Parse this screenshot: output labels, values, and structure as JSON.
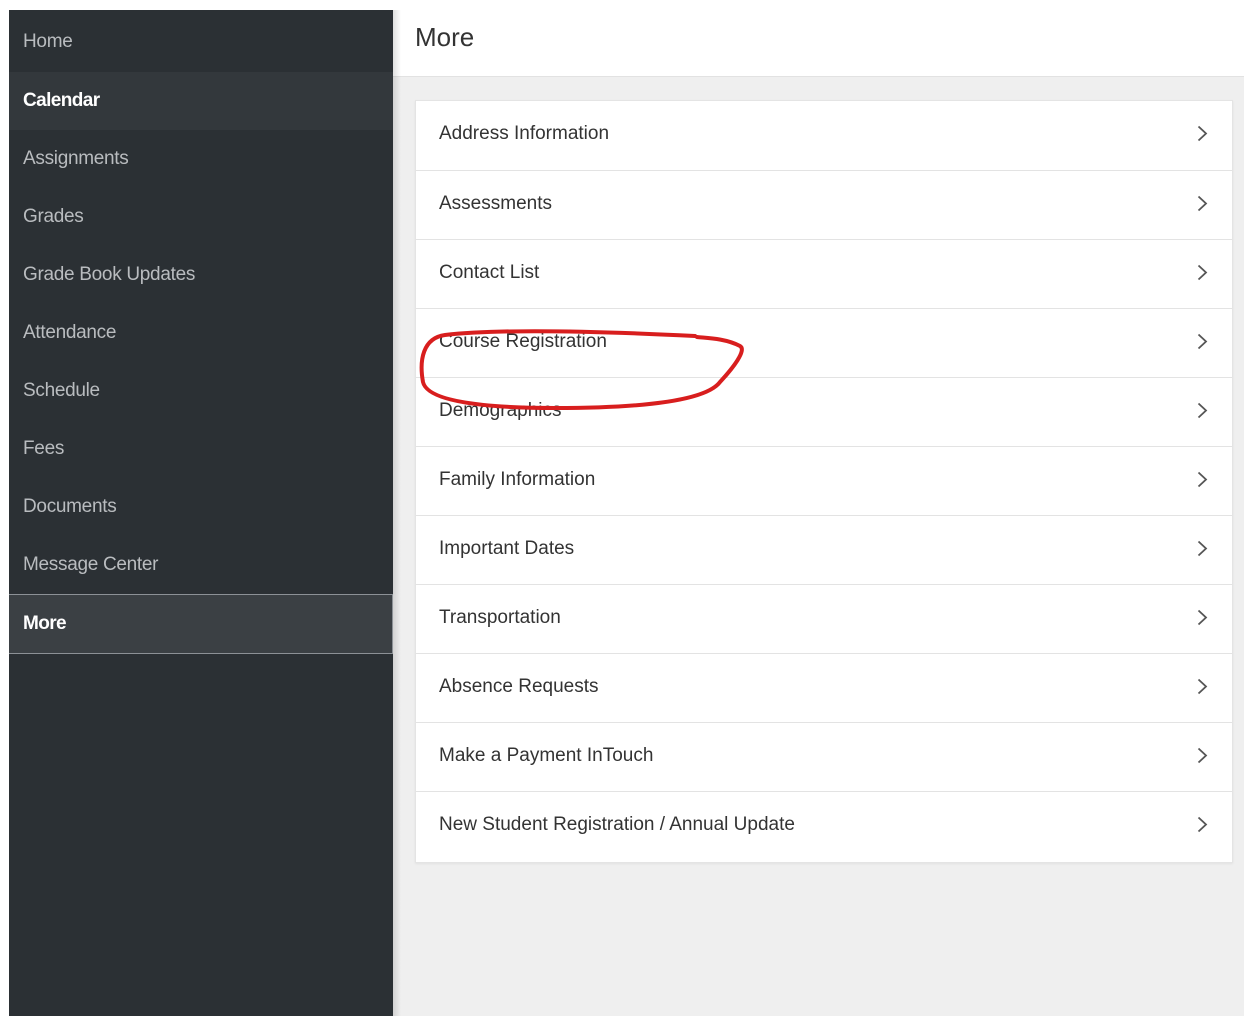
{
  "sidebar": {
    "items": [
      {
        "label": "Home"
      },
      {
        "label": "Calendar"
      },
      {
        "label": "Assignments"
      },
      {
        "label": "Grades"
      },
      {
        "label": "Grade Book Updates"
      },
      {
        "label": "Attendance"
      },
      {
        "label": "Schedule"
      },
      {
        "label": "Fees"
      },
      {
        "label": "Documents"
      },
      {
        "label": "Message Center"
      },
      {
        "label": "More"
      }
    ]
  },
  "main": {
    "title": "More",
    "list": [
      {
        "label": "Address Information",
        "icon": "chevron-right-icon"
      },
      {
        "label": "Assessments",
        "icon": "chevron-right-icon"
      },
      {
        "label": "Contact List",
        "icon": "chevron-right-icon"
      },
      {
        "label": "Course Registration",
        "icon": "chevron-right-icon"
      },
      {
        "label": "Demographics",
        "icon": "chevron-right-icon"
      },
      {
        "label": "Family Information",
        "icon": "chevron-right-icon"
      },
      {
        "label": "Important Dates",
        "icon": "chevron-right-icon"
      },
      {
        "label": "Transportation",
        "icon": "chevron-right-icon"
      },
      {
        "label": "Absence Requests",
        "icon": "chevron-right-icon"
      },
      {
        "label": "Make a Payment InTouch",
        "icon": "chevron-right-icon"
      },
      {
        "label": "New Student Registration / Annual Update",
        "icon": "chevron-right-icon"
      }
    ]
  },
  "colors": {
    "sidebar_bg": "#2b3034",
    "annotation": "#d81e1e"
  }
}
